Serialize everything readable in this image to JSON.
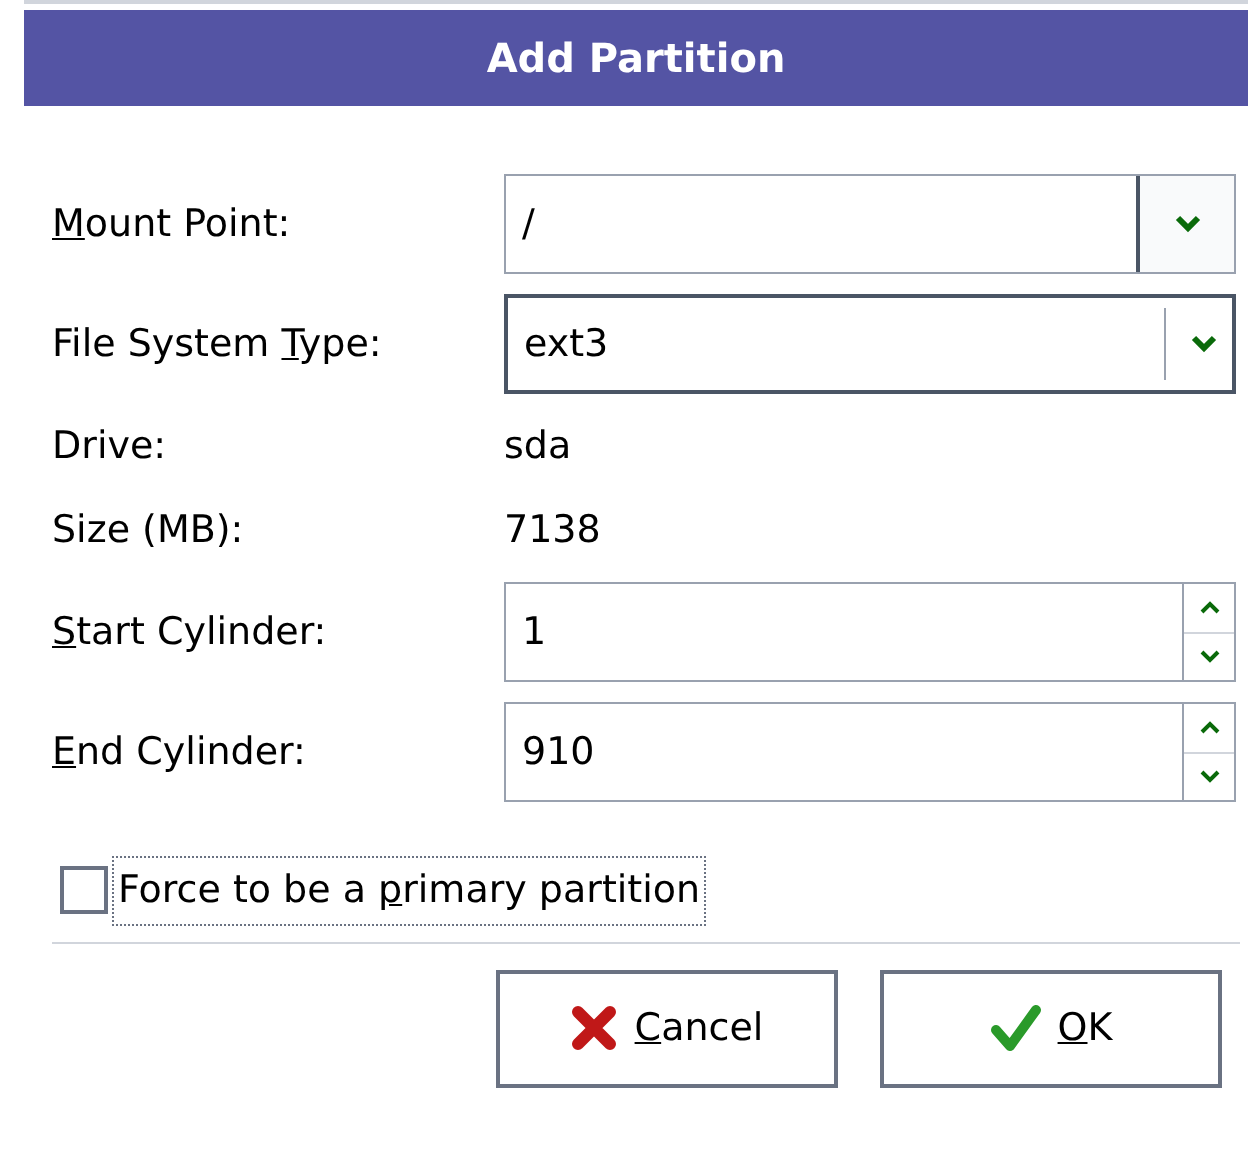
{
  "window": {
    "title": "Add Partition"
  },
  "fields": [
    {
      "kind": "combo",
      "label": {
        "key": "M",
        "post": "ount Point:"
      },
      "value": "/",
      "editable": true
    },
    {
      "kind": "combo",
      "label": {
        "pre": "File System ",
        "key": "T",
        "post": "ype:"
      },
      "value": "ext3",
      "editable": false
    },
    {
      "kind": "info",
      "label": {
        "pre": "Drive:"
      },
      "value": "sda"
    },
    {
      "kind": "info",
      "label": {
        "pre": "Size (MB):"
      },
      "value": "7138"
    },
    {
      "kind": "spin",
      "label": {
        "key": "S",
        "post": "tart Cylinder:"
      },
      "value": "1"
    },
    {
      "kind": "spin",
      "label": {
        "key": "E",
        "post": "nd Cylinder:"
      },
      "value": "910"
    }
  ],
  "checkbox": {
    "label": {
      "pre": "Force to be a ",
      "key": "p",
      "post": "rimary partition"
    },
    "checked": false,
    "focused": true
  },
  "buttons": [
    {
      "kind": "cancel",
      "label": {
        "key": "C",
        "post": "ancel"
      }
    },
    {
      "kind": "ok",
      "label": {
        "key": "O",
        "post": "K"
      }
    }
  ]
}
